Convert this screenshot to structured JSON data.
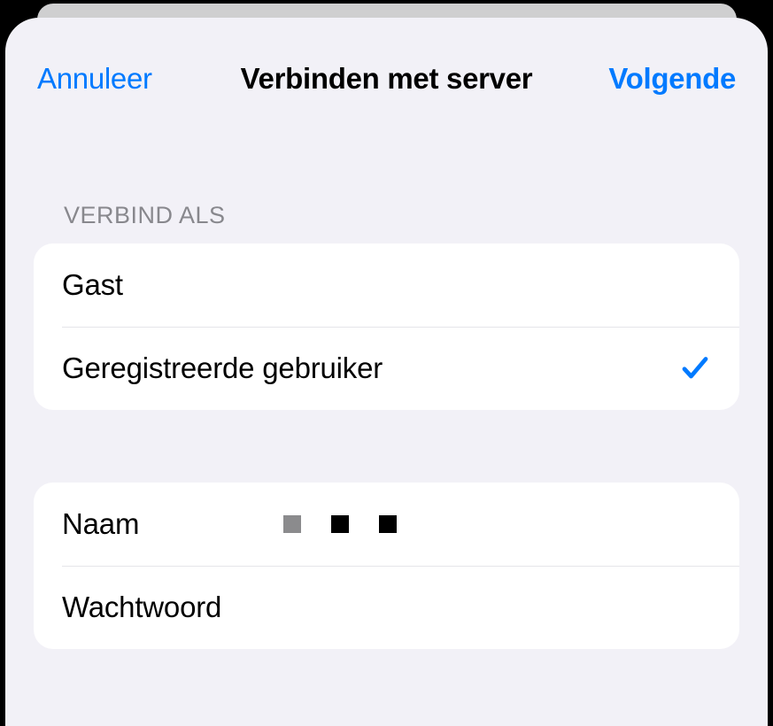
{
  "header": {
    "cancel_label": "Annuleer",
    "title": "Verbinden met server",
    "next_label": "Volgende"
  },
  "connect_as": {
    "section_title": "Verbind als",
    "guest_label": "Gast",
    "registered_label": "Geregistreerde gebruiker",
    "selected": "registered"
  },
  "credentials": {
    "name_label": "Naam",
    "name_value": "",
    "password_label": "Wachtwoord",
    "password_value": ""
  }
}
